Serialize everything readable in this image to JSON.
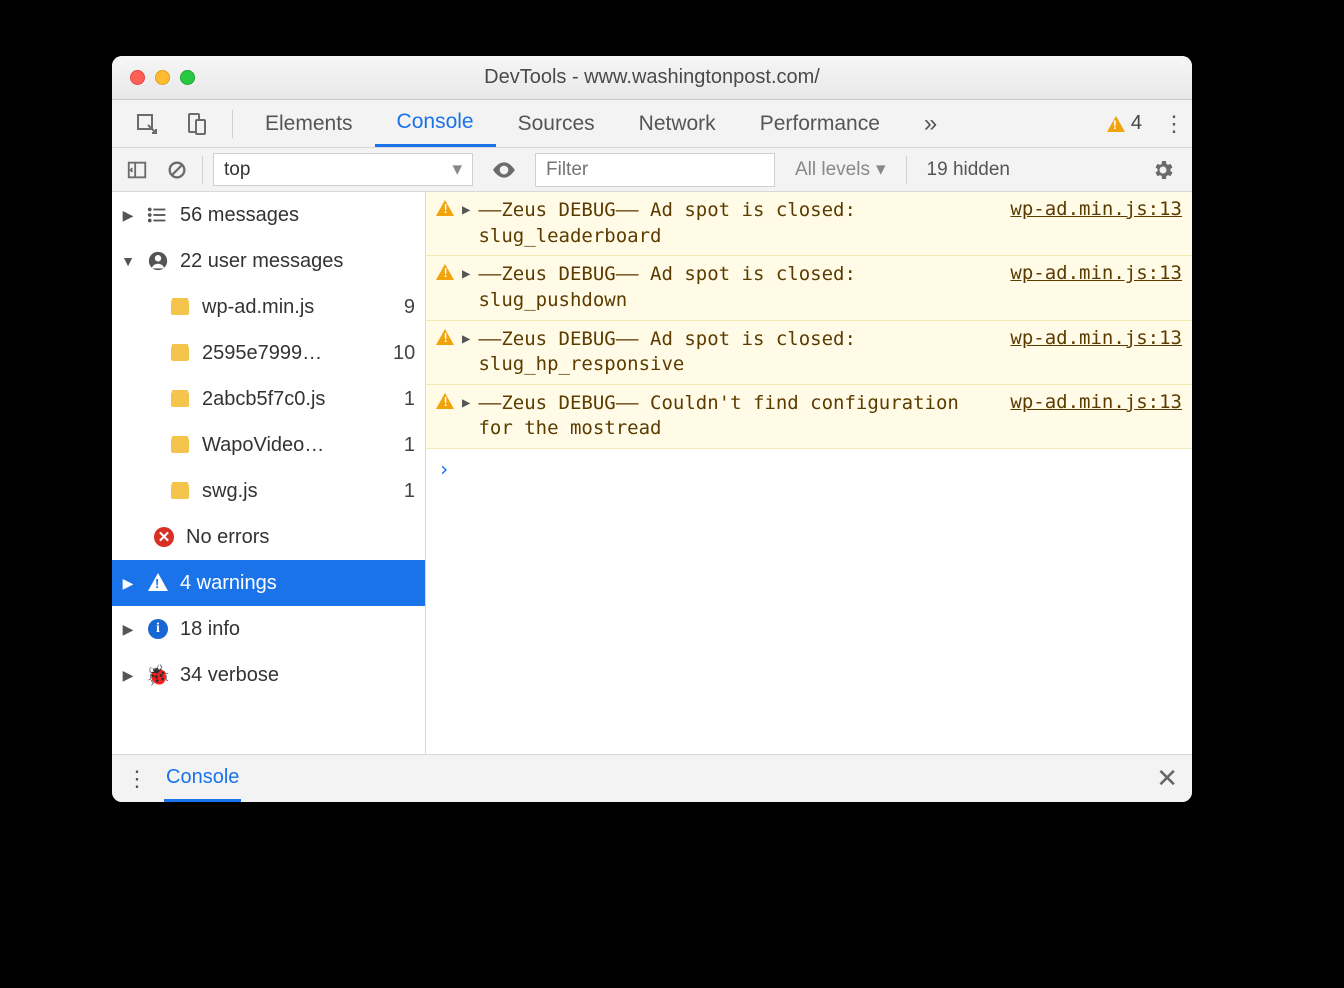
{
  "window": {
    "title": "DevTools - www.washingtonpost.com/"
  },
  "tabs": {
    "items": [
      "Elements",
      "Console",
      "Sources",
      "Network",
      "Performance"
    ],
    "active": "Console",
    "overflow_glyph": "»",
    "warn_count": "4"
  },
  "filter": {
    "context": "top",
    "placeholder": "Filter",
    "levels": "All levels",
    "hidden": "19 hidden"
  },
  "sidebar": {
    "messages": {
      "label": "56 messages"
    },
    "user_messages": {
      "label": "22 user messages"
    },
    "files": [
      {
        "name": "wp-ad.min.js",
        "count": "9"
      },
      {
        "name": "2595e7999…",
        "count": "10"
      },
      {
        "name": "2abcb5f7c0.js",
        "count": "1"
      },
      {
        "name": "WapoVideo…",
        "count": "1"
      },
      {
        "name": "swg.js",
        "count": "1"
      }
    ],
    "no_errors": "No errors",
    "warnings": "4 warnings",
    "info": "18 info",
    "verbose": "34 verbose"
  },
  "console": {
    "messages": [
      {
        "text": "––Zeus DEBUG–– Ad spot is closed: slug_leaderboard",
        "src": "wp-ad.min.js:13"
      },
      {
        "text": "––Zeus DEBUG–– Ad spot is closed: slug_pushdown",
        "src": "wp-ad.min.js:13"
      },
      {
        "text": "––Zeus DEBUG–– Ad spot is closed: slug_hp_responsive",
        "src": "wp-ad.min.js:13"
      },
      {
        "text": "––Zeus DEBUG–– Couldn't find configuration for the mostread",
        "src": "wp-ad.min.js:13"
      }
    ],
    "prompt": "›"
  },
  "drawer": {
    "tab": "Console"
  }
}
